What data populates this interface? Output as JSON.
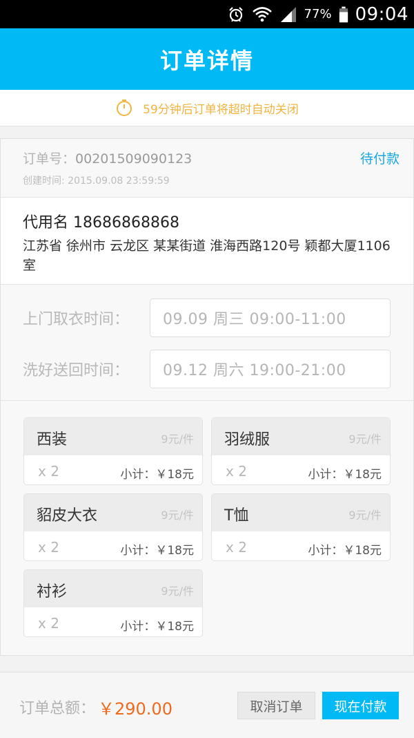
{
  "status_bar": {
    "battery_percent": "77%",
    "time": "09:04",
    "icons": [
      "alarm-icon",
      "wifi-icon",
      "signal-icon",
      "battery-icon"
    ]
  },
  "app_bar": {
    "title": "订单详情"
  },
  "notice": {
    "text": "59分钟后订单将超时自动关闭",
    "color": "#f2b441",
    "icon": "timer-icon"
  },
  "order": {
    "number_label": "订单号：",
    "number": "00201509090123",
    "status": "待付款",
    "created_label": "创建时间:",
    "created_value": "2015.09.08  23:59:59"
  },
  "address": {
    "name_phone": "代用名 18686868868",
    "address": "江苏省 徐州市 云龙区 某某街道 淮海西路120号 颖都大厦1106室"
  },
  "times": {
    "pickup_label": "上门取衣时间：",
    "pickup_value": "09.09 周三   09:00-11:00",
    "return_label": "洗好送回时间：",
    "return_value": "09.12 周六   19:00-21:00"
  },
  "items": [
    {
      "name": "西装",
      "price": "9元/件",
      "qty": "x 2",
      "subtotal": "小计：￥18元"
    },
    {
      "name": "羽绒服",
      "price": "9元/件",
      "qty": "x 2",
      "subtotal": "小计：￥18元"
    },
    {
      "name": "貂皮大衣",
      "price": "9元/件",
      "qty": "x 2",
      "subtotal": "小计：￥18元"
    },
    {
      "name": "T恤",
      "price": "9元/件",
      "qty": "x 2",
      "subtotal": "小计：￥18元"
    },
    {
      "name": "衬衫",
      "price": "9元/件",
      "qty": "x 2",
      "subtotal": "小计：￥18元"
    }
  ],
  "footer": {
    "total_label": "订单总额：",
    "total_amount": "￥290.00",
    "cancel_label": "取消订单",
    "pay_label": "现在付款"
  },
  "colors": {
    "accent": "#00b9f5",
    "status": "#18a8e0",
    "amount": "#f06a1e"
  }
}
